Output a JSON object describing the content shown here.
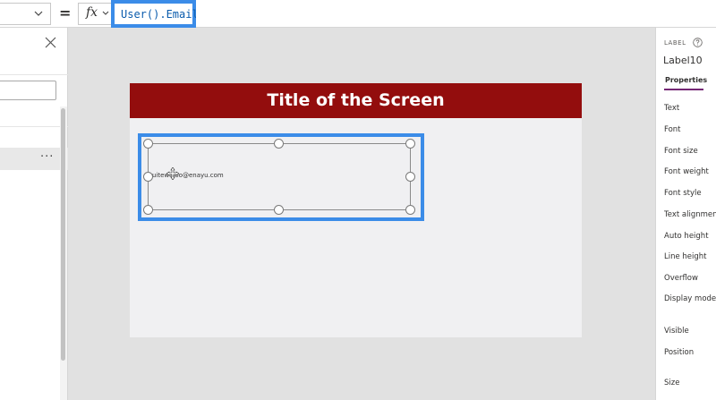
{
  "formula_bar": {
    "equals": "=",
    "fx_label": "fx",
    "formula": "User().Email"
  },
  "left_panel": {
    "more_label": "···"
  },
  "canvas": {
    "screen_title": "Title of the Screen",
    "label_text": "uitewaloo@enayu.com"
  },
  "right_panel": {
    "control_type": "LABEL",
    "control_name": "Label10",
    "tab_label": "Properties",
    "properties": [
      "Text",
      "Font",
      "Font size",
      "Font weight",
      "Font style",
      "Text alignment",
      "Auto height",
      "Line height",
      "Overflow",
      "Display mode",
      "Visible",
      "Position",
      "Size"
    ]
  },
  "colors": {
    "accent_blue": "#3b8ce8",
    "title_bar": "#930d0d",
    "tab_underline": "#742774"
  }
}
